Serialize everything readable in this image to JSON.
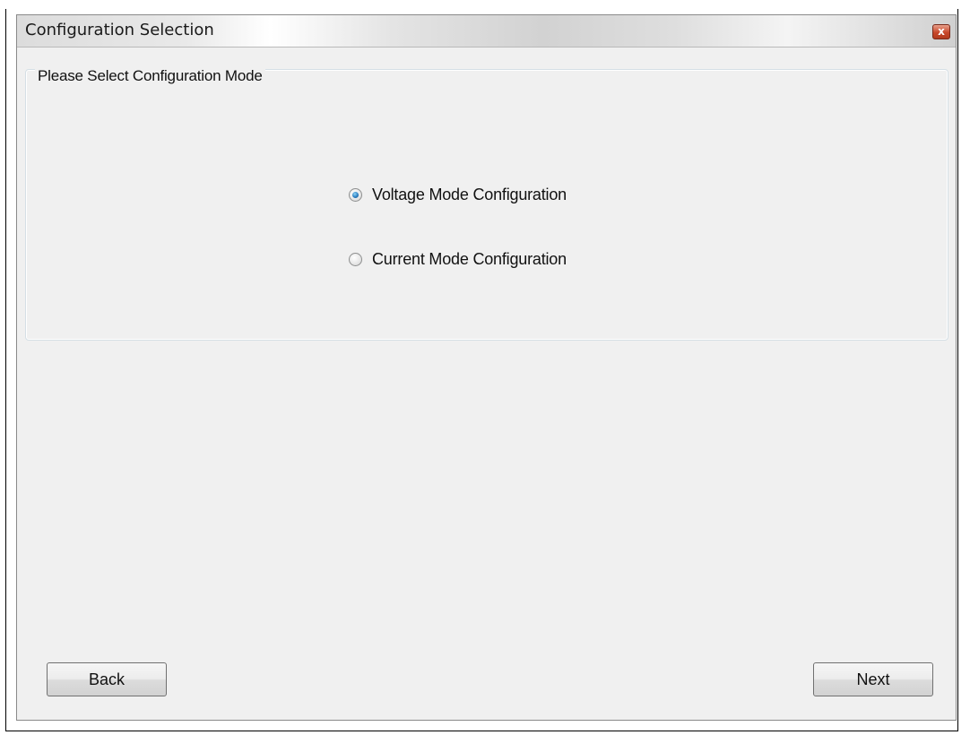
{
  "window": {
    "title": "Configuration Selection",
    "close_glyph": "x"
  },
  "group": {
    "legend": "Please Select Configuration Mode",
    "options": [
      {
        "label": "Voltage Mode Configuration",
        "checked": true
      },
      {
        "label": "Current Mode Configuration",
        "checked": false
      }
    ]
  },
  "buttons": {
    "back_label": "Back",
    "next_label": "Next"
  },
  "colors": {
    "window_bg": "#f0f0f0",
    "radio_accent": "#2d7fc1",
    "close_button": "#c8472a"
  }
}
